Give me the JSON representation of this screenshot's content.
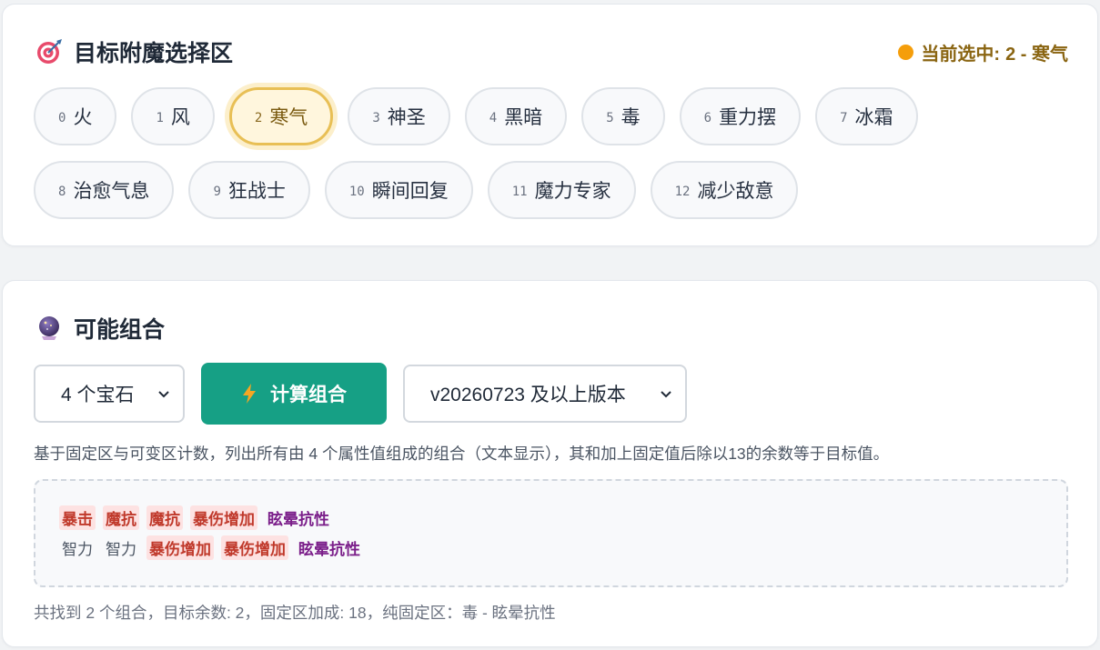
{
  "target_section": {
    "title": "目标附魔选择区",
    "title_icon": "target-icon",
    "current_label": "当前选中:",
    "current_value": "2 - 寒气",
    "enchants_row1": [
      {
        "num": "0",
        "name": "火"
      },
      {
        "num": "1",
        "name": "风"
      },
      {
        "num": "2",
        "name": "寒气",
        "selected": true
      },
      {
        "num": "3",
        "name": "神圣"
      },
      {
        "num": "4",
        "name": "黑暗"
      },
      {
        "num": "5",
        "name": "毒"
      },
      {
        "num": "6",
        "name": "重力摆"
      },
      {
        "num": "7",
        "name": "冰霜"
      }
    ],
    "enchants_row2": [
      {
        "num": "8",
        "name": "治愈气息"
      },
      {
        "num": "9",
        "name": "狂战士"
      },
      {
        "num": "10",
        "name": "瞬间回复"
      },
      {
        "num": "11",
        "name": "魔力专家"
      },
      {
        "num": "12",
        "name": "减少敌意"
      }
    ]
  },
  "combo_section": {
    "title": "可能组合",
    "title_icon": "crystal-ball-icon",
    "gem_select_value": "4 个宝石",
    "calc_button_label": "计算组合",
    "calc_button_icon": "lightning-icon",
    "version_select_value": "v20260723 及以上版本",
    "description": "基于固定区与可变区计数，列出所有由 4 个属性值组成的组合（文本显示），其和加上固定值后除以13的余数等于目标值。",
    "results": [
      [
        {
          "text": "暴击",
          "style": "red"
        },
        {
          "text": "魔抗",
          "style": "red"
        },
        {
          "text": "魔抗",
          "style": "red"
        },
        {
          "text": "暴伤增加",
          "style": "red"
        },
        {
          "text": "眩晕抗性",
          "style": "purple"
        }
      ],
      [
        {
          "text": "智力",
          "style": "plain"
        },
        {
          "text": "智力",
          "style": "plain"
        },
        {
          "text": "暴伤增加",
          "style": "red"
        },
        {
          "text": "暴伤增加",
          "style": "red"
        },
        {
          "text": "眩晕抗性",
          "style": "purple"
        }
      ]
    ],
    "summary": "共找到 2 个组合，目标余数: 2，固定区加成: 18，纯固定区：毒 - 眩晕抗性"
  },
  "colors": {
    "accent": "#16a085",
    "selected_border": "#e8bf55",
    "selected_bg": "#fff6dd",
    "current_text": "#8a6512",
    "token_red": "#c0392b",
    "token_purple": "#7b1f8a"
  }
}
